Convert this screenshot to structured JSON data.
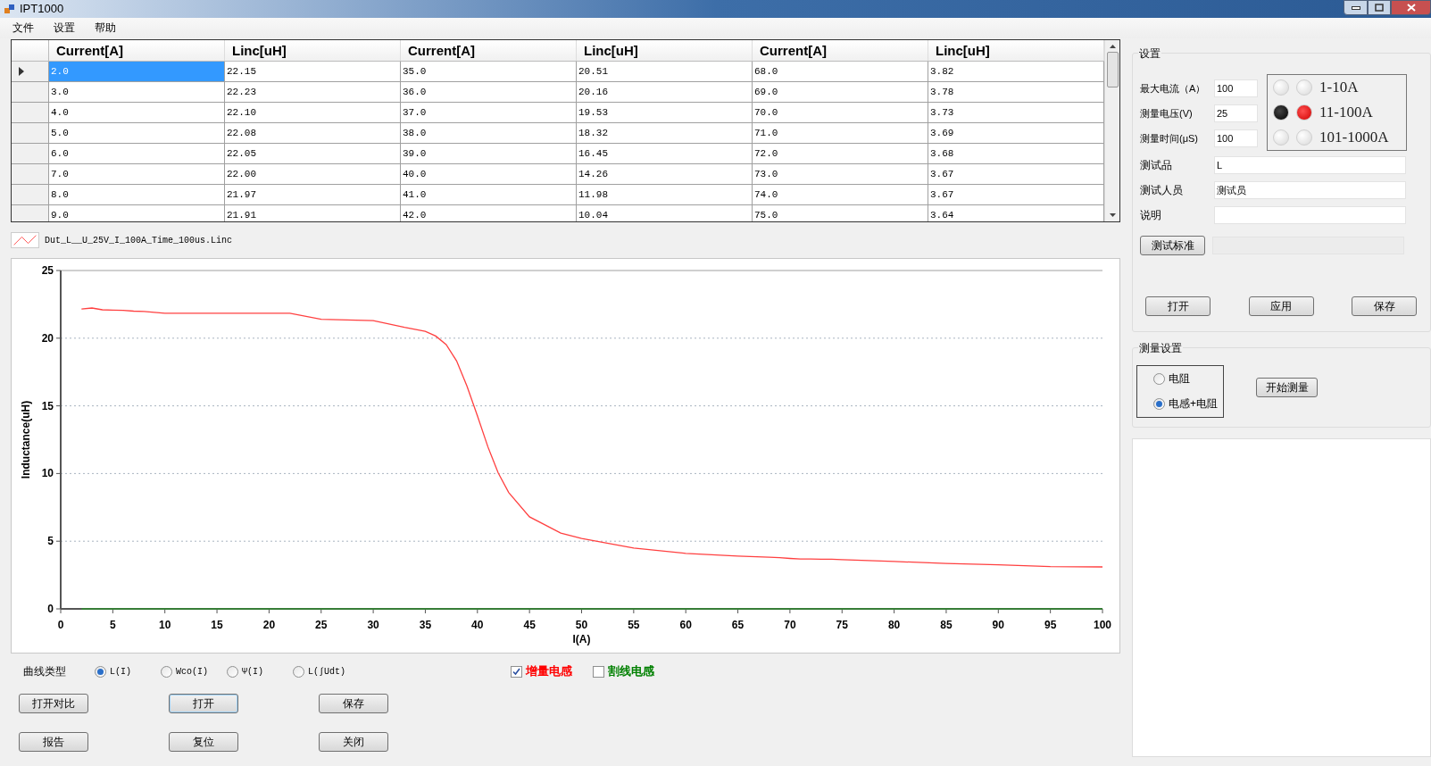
{
  "window": {
    "title": "IPT1000"
  },
  "menu": [
    "文件",
    "设置",
    "帮助"
  ],
  "table": {
    "columns": [
      "Current[A]",
      "Linc[uH]",
      "Current[A]",
      "Linc[uH]",
      "Current[A]",
      "Linc[uH]"
    ],
    "rows": [
      {
        "selected": true,
        "cells": [
          "2.0",
          "22.15",
          "35.0",
          "20.51",
          "68.0",
          "3.82"
        ]
      },
      {
        "selected": false,
        "cells": [
          "3.0",
          "22.23",
          "36.0",
          "20.16",
          "69.0",
          "3.78"
        ]
      },
      {
        "selected": false,
        "cells": [
          "4.0",
          "22.10",
          "37.0",
          "19.53",
          "70.0",
          "3.73"
        ]
      },
      {
        "selected": false,
        "cells": [
          "5.0",
          "22.08",
          "38.0",
          "18.32",
          "71.0",
          "3.69"
        ]
      },
      {
        "selected": false,
        "cells": [
          "6.0",
          "22.05",
          "39.0",
          "16.45",
          "72.0",
          "3.68"
        ]
      },
      {
        "selected": false,
        "cells": [
          "7.0",
          "22.00",
          "40.0",
          "14.26",
          "73.0",
          "3.67"
        ]
      },
      {
        "selected": false,
        "cells": [
          "8.0",
          "21.97",
          "41.0",
          "11.98",
          "74.0",
          "3.67"
        ]
      },
      {
        "selected": false,
        "cells": [
          "9.0",
          "21.91",
          "42.0",
          "10.04",
          "75.0",
          "3.64"
        ]
      }
    ]
  },
  "chart": {
    "chart_data": {
      "type": "line",
      "grid": true,
      "xlabel": "I(A)",
      "ylabel": "Inductance(uH)",
      "xlim": [
        0,
        100
      ],
      "ylim": [
        0,
        25
      ],
      "xticks": [
        0,
        5,
        10,
        15,
        20,
        25,
        30,
        35,
        40,
        45,
        50,
        55,
        60,
        65,
        70,
        75,
        80,
        85,
        90,
        95,
        100
      ],
      "yticks": [
        0,
        5,
        10,
        15,
        20,
        25
      ],
      "x": [
        2,
        3,
        4,
        5,
        6,
        7,
        8,
        9,
        10,
        15,
        20,
        22,
        25,
        30,
        33,
        35,
        36,
        37,
        38,
        39,
        40,
        41,
        42,
        43,
        45,
        48,
        50,
        55,
        60,
        65,
        68,
        69,
        70,
        71,
        72,
        73,
        74,
        75,
        80,
        85,
        90,
        95,
        100
      ],
      "series": [
        {
          "name": "Dut_L__U_25V_I_100A_Time_100us.Linc",
          "color": "#ff4040",
          "values": [
            22.15,
            22.23,
            22.1,
            22.08,
            22.05,
            22.0,
            21.97,
            21.91,
            21.85,
            21.85,
            21.85,
            21.85,
            21.4,
            21.3,
            20.8,
            20.51,
            20.16,
            19.53,
            18.32,
            16.45,
            14.26,
            11.98,
            10.04,
            8.6,
            6.8,
            5.6,
            5.2,
            4.5,
            4.1,
            3.9,
            3.82,
            3.78,
            3.73,
            3.69,
            3.68,
            3.67,
            3.67,
            3.64,
            3.5,
            3.35,
            3.25,
            3.12,
            3.1
          ]
        },
        {
          "color": "#2e8b2e",
          "values": [
            0,
            0,
            0,
            0,
            0,
            0,
            0,
            0,
            0,
            0,
            0,
            0,
            0,
            0,
            0,
            0,
            0,
            0,
            0,
            0,
            0,
            0,
            0,
            0,
            0,
            0,
            0,
            0,
            0,
            0,
            0,
            0,
            0,
            0,
            0,
            0,
            0,
            0,
            0,
            0,
            0,
            0,
            0
          ]
        }
      ]
    }
  },
  "curve_type": {
    "label": "曲线类型",
    "options": [
      {
        "label": "L(I)",
        "selected": true
      },
      {
        "label": "Wco(I)",
        "selected": false
      },
      {
        "label": "Ψ(I)",
        "selected": false
      },
      {
        "label": "L(∫Udt)",
        "selected": false
      }
    ]
  },
  "checkboxes": [
    {
      "label": "增量电感",
      "checked": true,
      "color": "#ff0000"
    },
    {
      "label": "割线电感",
      "checked": false,
      "color": "#008000"
    }
  ],
  "buttons": [
    [
      {
        "label": "打开对比",
        "focused": false
      },
      {
        "label": "打开",
        "focused": true
      },
      {
        "label": "保存",
        "focused": false
      }
    ],
    [
      {
        "label": "报告",
        "focused": false
      },
      {
        "label": "复位",
        "focused": false
      },
      {
        "label": "关闭",
        "focused": false
      }
    ]
  ],
  "settings": {
    "title": "设置",
    "fields": [
      {
        "label": "最大电流（A）",
        "value": "100"
      },
      {
        "label": "测量电压(V)",
        "value": "25"
      },
      {
        "label": "测量时间(μS)",
        "value": "100"
      }
    ],
    "ranges": [
      {
        "label": "1-10A",
        "selected": false
      },
      {
        "label": "11-100A",
        "selected": true
      },
      {
        "label": "101-1000A",
        "selected": false
      }
    ],
    "info_fields": [
      {
        "label": "测试品",
        "value": "L"
      },
      {
        "label": "测试人员",
        "value": "测试员"
      },
      {
        "label": "说明"
      }
    ],
    "standard_button": "测试标准",
    "buttons": [
      "打开",
      "应用",
      "保存"
    ]
  },
  "measure": {
    "title": "测量设置",
    "modes": [
      {
        "label": "电阻",
        "selected": false
      },
      {
        "label": "电感+电阻",
        "selected": true
      }
    ],
    "start_button": "开始测量"
  }
}
